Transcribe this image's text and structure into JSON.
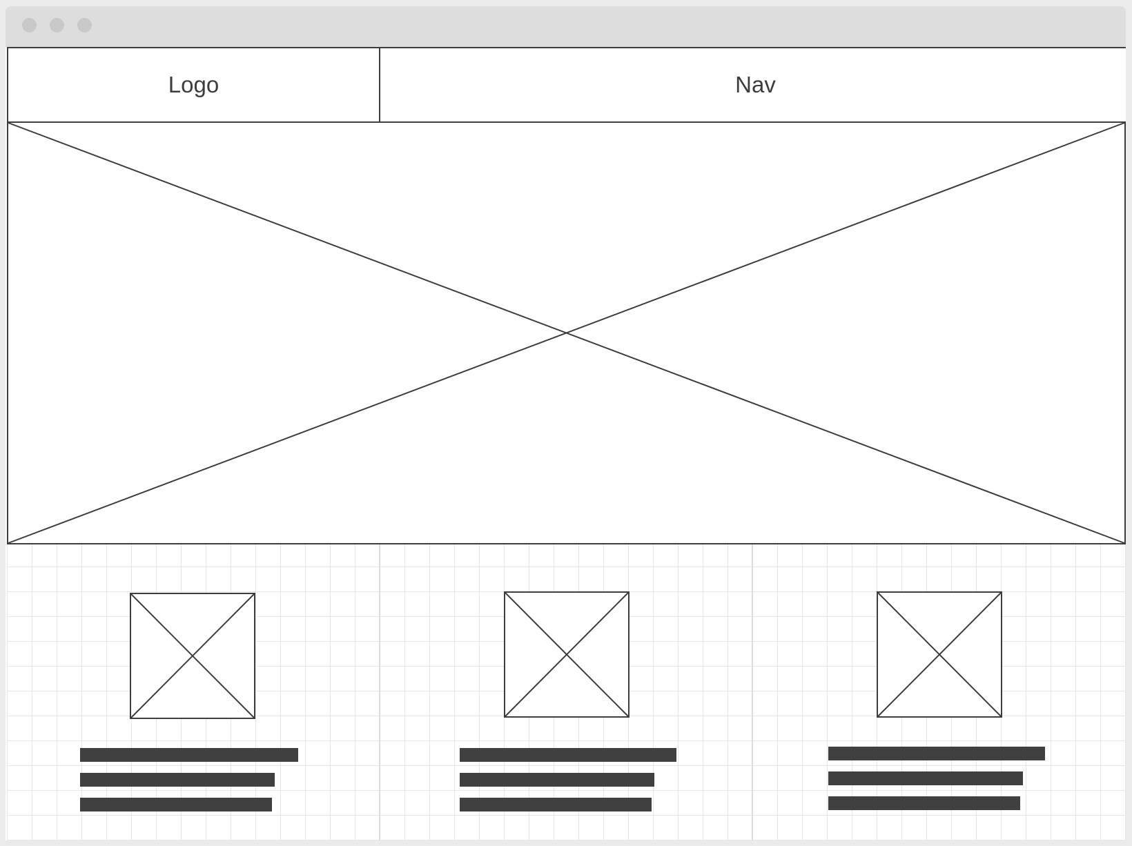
{
  "header": {
    "logo_label": "Logo",
    "nav_label": "Nav"
  },
  "icons": {
    "window_controls": [
      "close-dot",
      "minimize-dot",
      "maximize-dot"
    ],
    "image_placeholder": "crossed-box-placeholder",
    "text_placeholder": "text-line-bar"
  },
  "colors": {
    "stroke": "#3d3d3d",
    "text_bar": "#404040",
    "titlebar": "#dddddd",
    "grid_line": "#e6e6e6",
    "background": "#ebebeb"
  },
  "columns": [
    {
      "thumbnail": "image-placeholder",
      "text_lines": 3
    },
    {
      "thumbnail": "image-placeholder",
      "text_lines": 3
    },
    {
      "thumbnail": "image-placeholder",
      "text_lines": 3
    }
  ]
}
